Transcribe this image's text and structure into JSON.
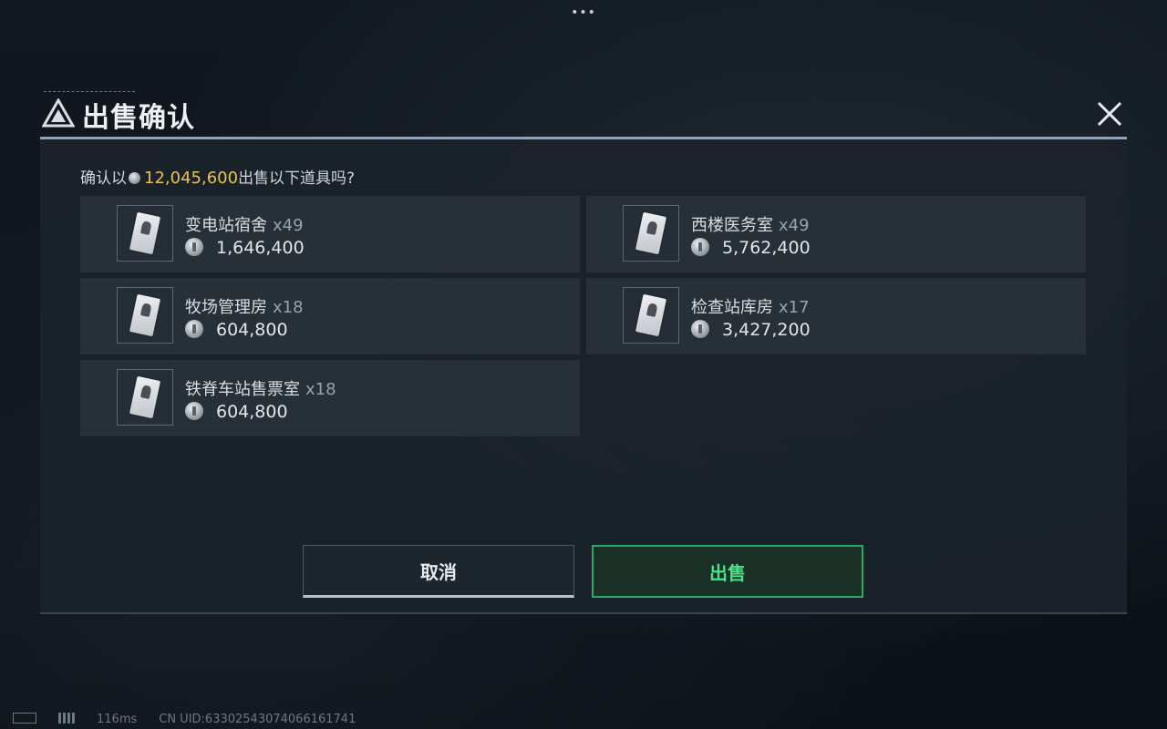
{
  "dialog": {
    "title": "出售确认",
    "prompt_prefix": "确认以",
    "total_amount": "12,045,600",
    "prompt_suffix": "出售以下道具吗?"
  },
  "items": [
    {
      "name": "变电站宿舍",
      "qty": "x49",
      "price": "1,646,400"
    },
    {
      "name": "西楼医务室",
      "qty": "x49",
      "price": "5,762,400"
    },
    {
      "name": "牧场管理房",
      "qty": "x18",
      "price": "604,800"
    },
    {
      "name": "检查站库房",
      "qty": "x17",
      "price": "3,427,200"
    },
    {
      "name": "铁脊车站售票室",
      "qty": "x18",
      "price": "604,800"
    }
  ],
  "buttons": {
    "cancel_label": "取消",
    "sell_label": "出售"
  },
  "status": {
    "ping": "116ms",
    "uid": "CN UID:633025430740661617​41"
  },
  "top_menu": "•••",
  "colors": {
    "accent_amount": "#e9c44a",
    "sell_green": "#4ee08a"
  },
  "icons": [
    "logo-icon",
    "close-icon",
    "coin-icon",
    "item-card-icon"
  ]
}
